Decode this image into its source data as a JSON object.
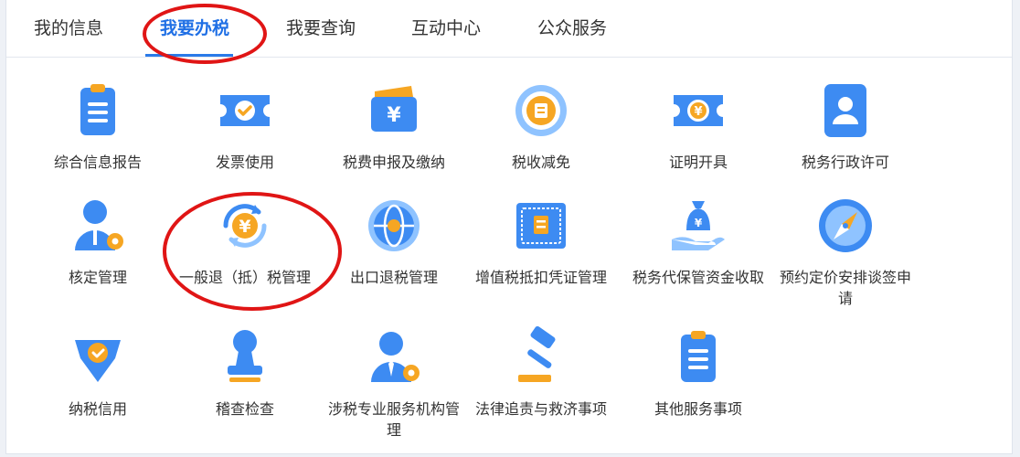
{
  "tabs": [
    "我的信息",
    "我要办税",
    "我要查询",
    "互动中心",
    "公众服务"
  ],
  "active_tab": "我要办税",
  "items": [
    {
      "label": "综合信息报告",
      "icon": "clipboard-icon"
    },
    {
      "label": "发票使用",
      "icon": "ticket-check-icon"
    },
    {
      "label": "税费申报及缴纳",
      "icon": "wallet-yuan-icon"
    },
    {
      "label": "税收减免",
      "icon": "tax-relief-icon"
    },
    {
      "label": "证明开具",
      "icon": "certificate-yuan-icon"
    },
    {
      "label": "税务行政许可",
      "icon": "id-badge-icon"
    },
    {
      "label": "核定管理",
      "icon": "user-gear-icon"
    },
    {
      "label": "一般退（抵）税管理",
      "icon": "refund-cycle-icon"
    },
    {
      "label": "出口退税管理",
      "icon": "globe-icon"
    },
    {
      "label": "增值税抵扣凭证管理",
      "icon": "invoice-voucher-icon"
    },
    {
      "label": "税务代保管资金收取",
      "icon": "money-bag-hand-icon"
    },
    {
      "label": "预约定价安排谈签申请",
      "icon": "compass-icon"
    },
    {
      "label": "纳税信用",
      "icon": "diamond-check-icon"
    },
    {
      "label": "稽查检查",
      "icon": "stamp-icon"
    },
    {
      "label": "涉税专业服务机构管理",
      "icon": "agent-gear-icon"
    },
    {
      "label": "法律追责与救济事项",
      "icon": "gavel-icon"
    },
    {
      "label": "其他服务事项",
      "icon": "notepad-icon"
    }
  ],
  "colors": {
    "accent_blue": "#2a7ae8",
    "icon_blue": "#3d8bf2",
    "icon_light": "#8fc3ff",
    "icon_orange": "#f6a623",
    "highlight_red": "#e01515"
  }
}
